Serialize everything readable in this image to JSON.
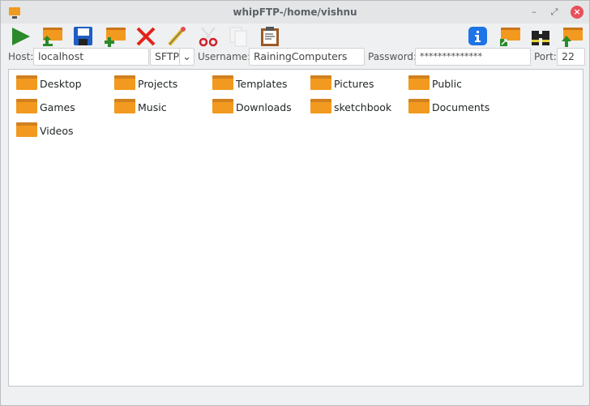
{
  "window": {
    "title": "whipFTP-/home/vishnu"
  },
  "connection": {
    "host_label": "Host:",
    "host": "localhost",
    "protocol": "SFTP",
    "username_label": "Username:",
    "username": "RainingComputers",
    "password_label": "Password:",
    "password": "**************",
    "port_label": "Port:",
    "port": "22"
  },
  "toolbar": [
    "connect",
    "upload",
    "save-download",
    "new-folder",
    "delete",
    "rename",
    "cut",
    "copy",
    "paste",
    "properties",
    "upload-folder",
    "search",
    "parent-directory"
  ],
  "files": [
    "Desktop",
    "Projects",
    "Templates",
    "Pictures",
    "Public",
    "Games",
    "Music",
    "Downloads",
    "sketchbook",
    "Documents",
    "Videos"
  ],
  "colors": {
    "folder": "#f29a1f",
    "accent": "#1d6ee0"
  }
}
